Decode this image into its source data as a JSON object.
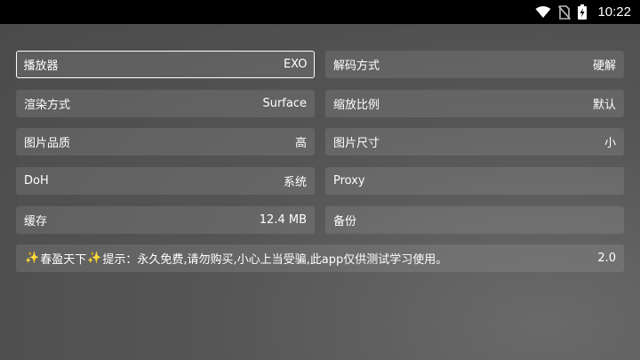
{
  "status_bar": {
    "time": "10:22",
    "icons": [
      "wifi-icon",
      "no-sim-icon",
      "battery-charging-icon"
    ]
  },
  "settings": {
    "player": {
      "label": "播放器",
      "value": "EXO"
    },
    "decode": {
      "label": "解码方式",
      "value": "硬解"
    },
    "render": {
      "label": "渲染方式",
      "value": "Surface"
    },
    "scale": {
      "label": "缩放比例",
      "value": "默认"
    },
    "image_quality": {
      "label": "图片品质",
      "value": "高"
    },
    "image_size": {
      "label": "图片尺寸",
      "value": "小"
    },
    "doh": {
      "label": "DoH",
      "value": "系统"
    },
    "proxy": {
      "label": "Proxy",
      "value": ""
    },
    "cache": {
      "label": "缓存",
      "value": "12.4 MB"
    },
    "backup": {
      "label": "备份",
      "value": ""
    }
  },
  "notice": {
    "sparkle": "✨",
    "name": "春盈天下",
    "text": "提示：永久免费,请勿购买,小心上当受骗,此app仅供测试学习使用。",
    "version": "2.0"
  },
  "colors": {
    "sparkle": "#f2c94c",
    "status_bar_bg": "#000000"
  }
}
